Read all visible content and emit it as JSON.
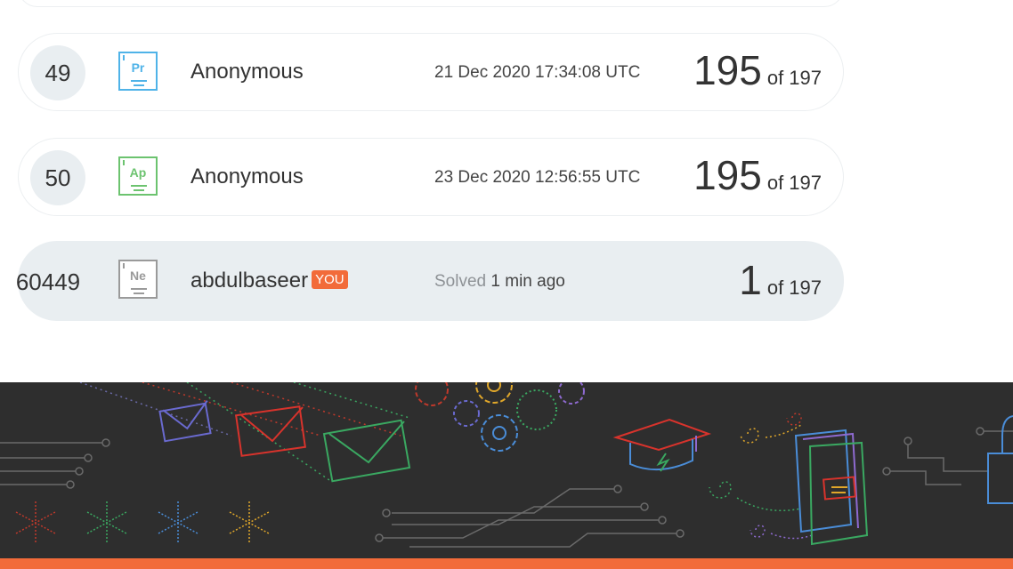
{
  "leaderboard": {
    "rows": [
      {
        "rank": "49",
        "element": "Pr",
        "name": "Anonymous",
        "date": "21 Dec 2020 17:34:08 UTC",
        "score": "195",
        "of": "of 197",
        "badge_color": "#4fb3e8"
      },
      {
        "rank": "50",
        "element": "Ap",
        "name": "Anonymous",
        "date": "23 Dec 2020 12:56:55 UTC",
        "score": "195",
        "of": "of 197",
        "badge_color": "#6cc36f"
      }
    ],
    "current_user": {
      "rank": "60449",
      "element": "Ne",
      "name": "abdulbaseer",
      "you_label": "YOU",
      "solved_label": "Solved",
      "solved_time": "1 min ago",
      "score": "1",
      "of": "of 197",
      "badge_color": "#9a9a9a"
    }
  },
  "footer": {
    "background": "#2e2e2e",
    "accent": "#f26b3a",
    "decorations": [
      "envelope-icon",
      "gear-icon",
      "graduation-cap-icon",
      "book-icon",
      "asterisk-icon",
      "circuit-lines",
      "padlock-icon"
    ]
  }
}
